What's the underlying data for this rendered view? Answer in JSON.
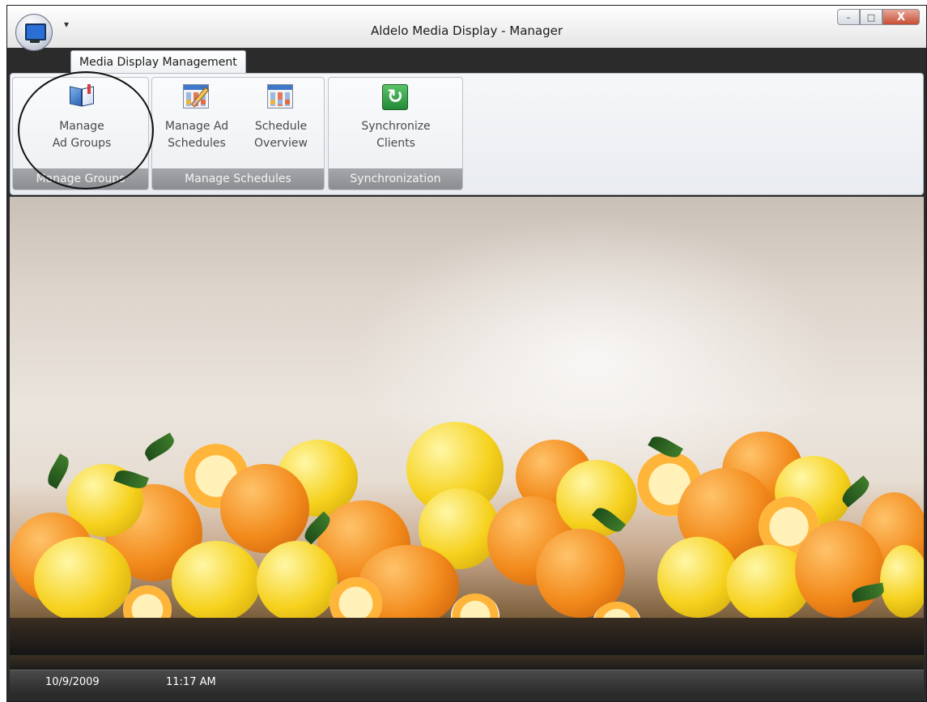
{
  "window": {
    "title": "Aldelo Media Display - Manager",
    "qat_glyph": "▾",
    "buttons": {
      "minimize": "–",
      "maximize": "□",
      "close": "X"
    }
  },
  "tabs": [
    {
      "label": "Media Display Management"
    }
  ],
  "ribbon": {
    "groups": [
      {
        "label": "Manage Groups",
        "buttons": [
          {
            "line1": "Manage",
            "line2": "Ad Groups",
            "icon": "open-book-icon"
          }
        ]
      },
      {
        "label": "Manage Schedules",
        "buttons": [
          {
            "line1": "Manage Ad",
            "line2": "Schedules",
            "icon": "calendar-edit-icon"
          },
          {
            "line1": "Schedule",
            "line2": "Overview",
            "icon": "calendar-icon"
          }
        ]
      },
      {
        "label": "Synchronization",
        "buttons": [
          {
            "line1": "Synchronize",
            "line2": "Clients",
            "icon": "sync-icon"
          }
        ]
      }
    ]
  },
  "status": {
    "date": "10/9/2009",
    "time": "11:17 AM"
  },
  "colors": {
    "chrome_dark": "#2b2b2b",
    "group_label": "#8a8d91",
    "ribbon": "#e9ecf0"
  }
}
